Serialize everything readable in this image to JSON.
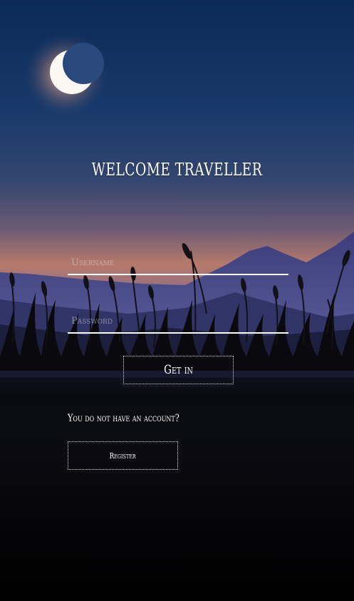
{
  "login": {
    "title": "WELCOME TRAVELLER",
    "username_placeholder": "Username",
    "password_placeholder": "Password",
    "submit_label": "Get in",
    "no_account_text": "You do not have an account?",
    "register_label": "Register"
  },
  "theme": {
    "sky_top": "#0e2d58",
    "sky_mid": "#2c4a78",
    "horizon_glow": "#d38a63",
    "mountain": "#4b4f8c",
    "ground": "#000000",
    "text": "#ffffff"
  },
  "background": {
    "moon_icon": "crescent-moon-icon",
    "scenery": "night-mountain-grass-scenery"
  }
}
